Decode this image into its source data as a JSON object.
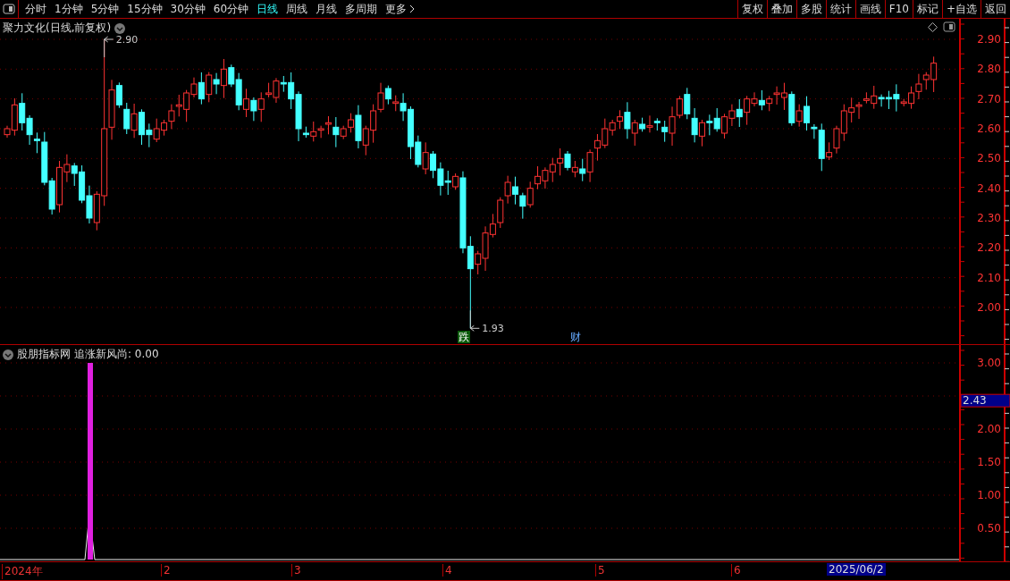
{
  "toolbar": {
    "periods": [
      {
        "label": "分时",
        "selected": false
      },
      {
        "label": "1分钟",
        "selected": false
      },
      {
        "label": "5分钟",
        "selected": false
      },
      {
        "label": "15分钟",
        "selected": false
      },
      {
        "label": "30分钟",
        "selected": false
      },
      {
        "label": "60分钟",
        "selected": false
      },
      {
        "label": "日线",
        "selected": true
      },
      {
        "label": "周线",
        "selected": false
      },
      {
        "label": "月线",
        "selected": false
      },
      {
        "label": "多周期",
        "selected": false
      }
    ],
    "more": "更多",
    "actions": [
      "复权",
      "叠加",
      "多股",
      "统计",
      "画线",
      "F10",
      "标记",
      "+自选",
      "返回"
    ]
  },
  "price_pane": {
    "title": "聚力文化(日线,前复权)",
    "high_label": "2.90",
    "low_label": "1.93",
    "markers": [
      {
        "text": "跌",
        "kind": "down"
      },
      {
        "text": "财",
        "kind": "finance"
      }
    ],
    "axis_ticks": [
      "2.90",
      "2.80",
      "2.70",
      "2.60",
      "2.50",
      "2.40",
      "2.30",
      "2.20",
      "2.10",
      "2.00"
    ]
  },
  "indicator_pane": {
    "source": "股朋指标网",
    "title": "追涨新风尚: 0.00",
    "axis_ticks": [
      "3.00",
      "2.00",
      "1.50",
      "1.00",
      "0.50"
    ],
    "cursor_value": "2.43"
  },
  "date_axis": {
    "labels": [
      "2024年",
      "2",
      "3",
      "4",
      "5",
      "6"
    ],
    "cursor_date": "2025/06/2"
  }
}
